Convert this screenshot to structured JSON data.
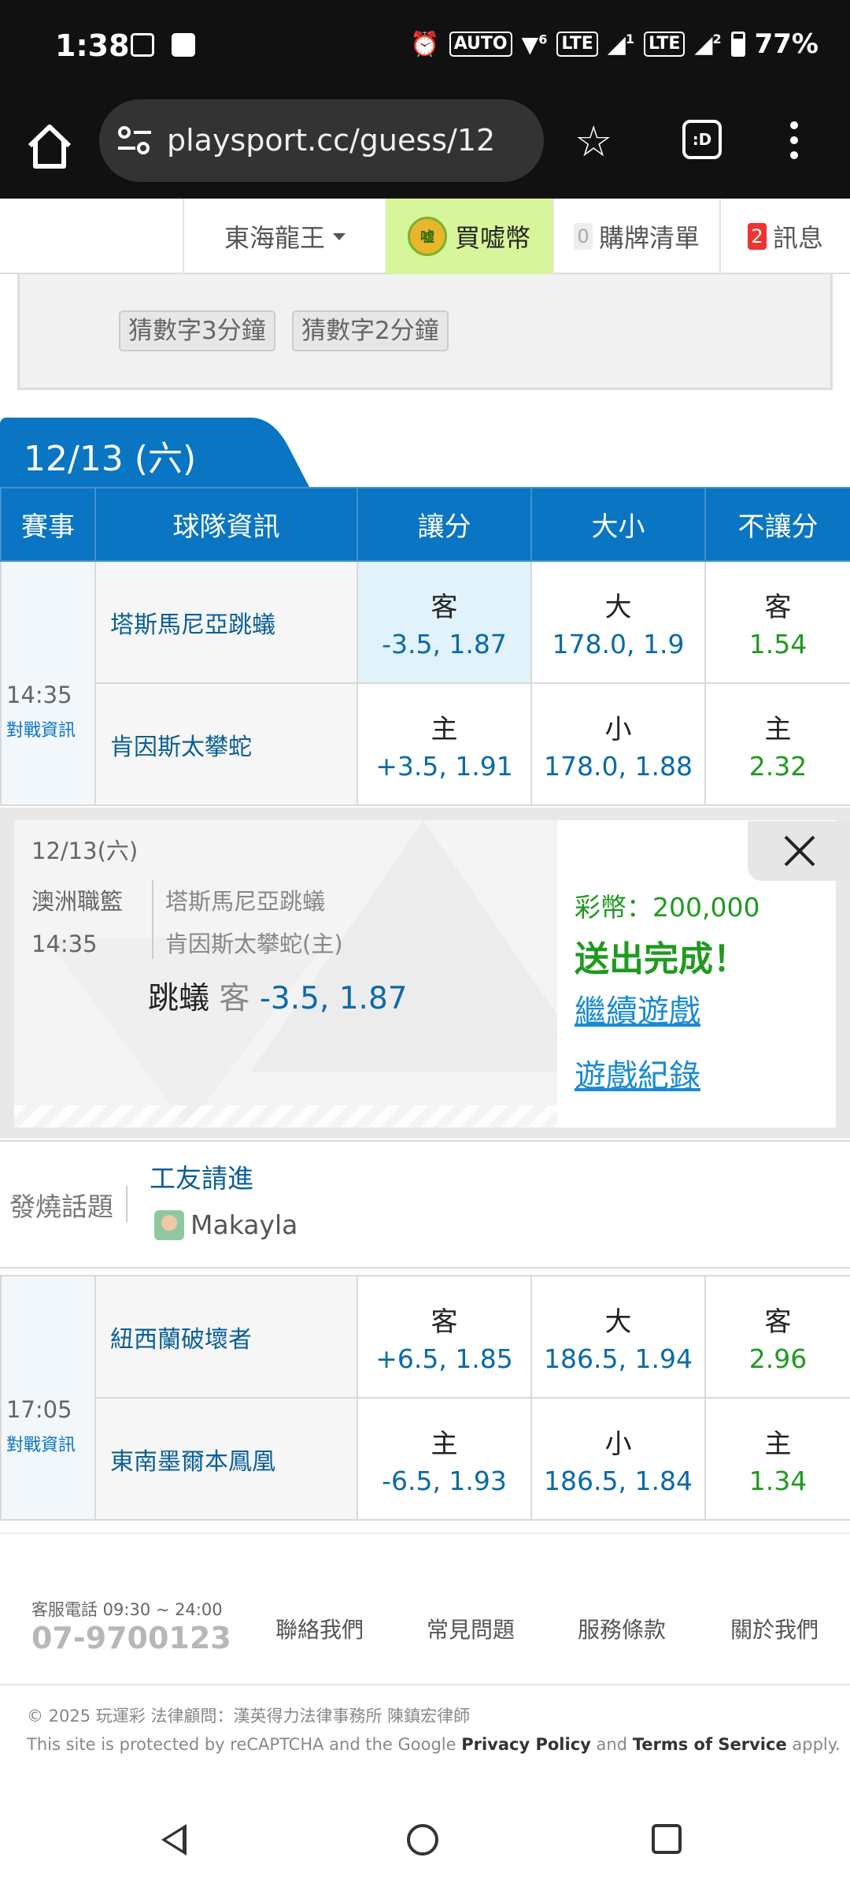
{
  "status_bar": {
    "time": "1:38",
    "battery": "77%",
    "icons": [
      "gallery-icon",
      "app-icon",
      "alarm-icon",
      "auto-hd-icon",
      "wifi-icon",
      "volte-icon",
      "signal-icon",
      "battery-icon"
    ],
    "auto_label": "AUTO",
    "sim1": "1",
    "sim2": "2",
    "wifi6": "6"
  },
  "browser": {
    "url": "playsport.cc/guess/12",
    "tabs_label": ":D"
  },
  "site_bar": {
    "user": "東海龍王",
    "buy_coin": "買嘘幣",
    "coin_icon_text": "嘘",
    "cart_count": "0",
    "cart_label": "購牌清單",
    "msg_count": "2",
    "msg_label": "訊息"
  },
  "filters": {
    "chips": [
      "猜數字3分鐘",
      "猜數字2分鐘"
    ]
  },
  "date_tab": "12/13 (六)",
  "table": {
    "headers": [
      "賽事",
      "球隊資訊",
      "讓分",
      "大小",
      "不讓分"
    ],
    "info_label": "對戰資訊",
    "games": [
      {
        "time": "14:35",
        "away": {
          "team": "塔斯馬尼亞跳蟻",
          "spread_side": "客",
          "spread": "-3.5, 1.87",
          "total_side": "大",
          "total": "178.0, 1.9",
          "ml_side": "客",
          "ml": "1.54"
        },
        "home": {
          "team": "肯因斯太攀蛇",
          "spread_side": "主",
          "spread": "+3.5, 1.91",
          "total_side": "小",
          "total": "178.0, 1.88",
          "ml_side": "主",
          "ml": "2.32"
        }
      },
      {
        "time": "17:05",
        "away": {
          "team": "紐西蘭破壞者",
          "spread_side": "客",
          "spread": "+6.5, 1.85",
          "total_side": "大",
          "total": "186.5, 1.94",
          "ml_side": "客",
          "ml": "2.96"
        },
        "home": {
          "team": "東南墨爾本鳳凰",
          "spread_side": "主",
          "spread": "-6.5, 1.93",
          "total_side": "小",
          "total": "186.5, 1.84",
          "ml_side": "主",
          "ml": "1.34"
        }
      }
    ]
  },
  "confirm": {
    "date": "12/13(六)",
    "league": "澳洲職籃",
    "time": "14:35",
    "away": "塔斯馬尼亞跳蟻",
    "home": "肯因斯太攀蛇(主)",
    "pick_name": "跳蟻",
    "pick_side": "客",
    "pick_odds": "-3.5, 1.87",
    "coin": "彩幣：200,000",
    "done": "送出完成！",
    "continue": "繼續遊戲",
    "history": "遊戲紀錄"
  },
  "hot_topic": {
    "label": "發燒話題",
    "title": "工友請進",
    "user": "Makayla"
  },
  "footer": {
    "phone_label": "客服電話 09:30 ~ 24:00",
    "phone": "07-9700123",
    "links": [
      "聯絡我們",
      "常見問題",
      "服務條款",
      "關於我們"
    ],
    "copyright": "© 2025 玩運彩 法律顧問：漢英得力法律事務所 陳鎮宏律師",
    "recaptcha_prefix": "This site is protected by reCAPTCHA and the Google ",
    "privacy": "Privacy Policy",
    "and": " and ",
    "terms": "Terms of Service",
    "apply": " apply."
  },
  "colors": {
    "brand_blue": "#0a75c2",
    "odds_green": "#1f9a1f",
    "odds_blue": "#0a6aa8",
    "buy_coin_bg": "#d7f59a",
    "badge_red": "#e33"
  }
}
